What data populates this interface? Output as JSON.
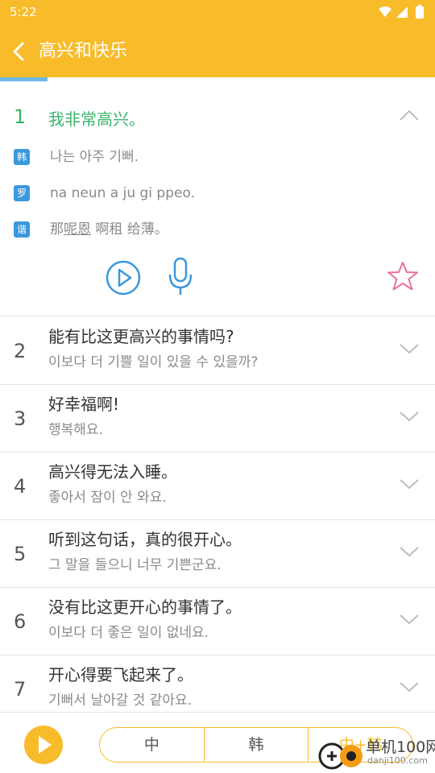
{
  "status": {
    "time": "5:22"
  },
  "header": {
    "title": "高兴和快乐",
    "progress_fraction": 0.11
  },
  "expanded": {
    "number": "1",
    "chinese": "我非常高兴。",
    "korean_badge": "韩",
    "korean": "나는 아주 기뻐.",
    "roman_badge": "罗",
    "romanization": "na neun a ju gi ppeo.",
    "homophone_badge": "谐",
    "homophone_before": "那",
    "homophone_underlined": "呢恩",
    "homophone_after": " 啊租 给薄。"
  },
  "sentences": [
    {
      "number": "2",
      "chinese": "能有比这更高兴的事情吗?",
      "korean": "이보다 더 기쁠 일이 있을 수 있을까?"
    },
    {
      "number": "3",
      "chinese": "好幸福啊!",
      "korean": "행복해요."
    },
    {
      "number": "4",
      "chinese": "高兴得无法入睡。",
      "korean": "좋아서 잠이 안 와요."
    },
    {
      "number": "5",
      "chinese": "听到这句话，真的很开心。",
      "korean": "그 말을 들으니 너무 기쁜군요."
    },
    {
      "number": "6",
      "chinese": "没有比这更开心的事情了。",
      "korean": "이보다 더 좋은 일이 없네요."
    },
    {
      "number": "7",
      "chinese": "开心得要飞起来了。",
      "korean": "기뻐서 날아갈 것 같아요."
    }
  ],
  "footer": {
    "modes": [
      "中",
      "韩",
      "中+韩"
    ]
  },
  "watermark": {
    "brand": "单机100网",
    "url": "danji100.com"
  },
  "colors": {
    "accent": "#f8bc2b",
    "green": "#38b36c",
    "blue": "#3a98dd",
    "star": "#ee6f9b"
  }
}
